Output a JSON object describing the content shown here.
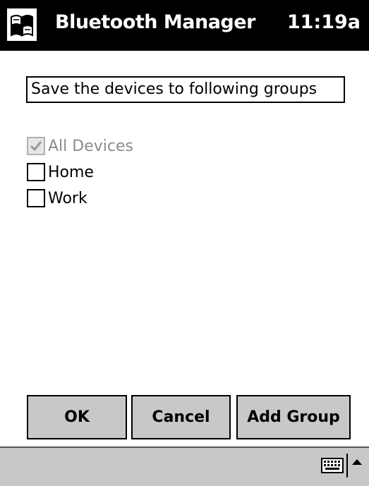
{
  "titlebar": {
    "app_title": "Bluetooth Manager",
    "clock": "11:19a",
    "start_icon": "windows-flag-icon"
  },
  "prompt": "Save the devices to following groups",
  "groups": [
    {
      "label": "All Devices",
      "checked": true,
      "disabled": true
    },
    {
      "label": "Home",
      "checked": false,
      "disabled": false
    },
    {
      "label": "Work",
      "checked": false,
      "disabled": false
    }
  ],
  "buttons": {
    "ok": "OK",
    "cancel": "Cancel",
    "add_group": "Add Group"
  },
  "menubar": {
    "keyboard_icon": "keyboard-icon",
    "sip_arrow_icon": "up-arrow-icon"
  },
  "colors": {
    "titlebar_bg": "#000000",
    "button_bg": "#c8c8c8",
    "disabled_text": "#8c8c8c"
  }
}
